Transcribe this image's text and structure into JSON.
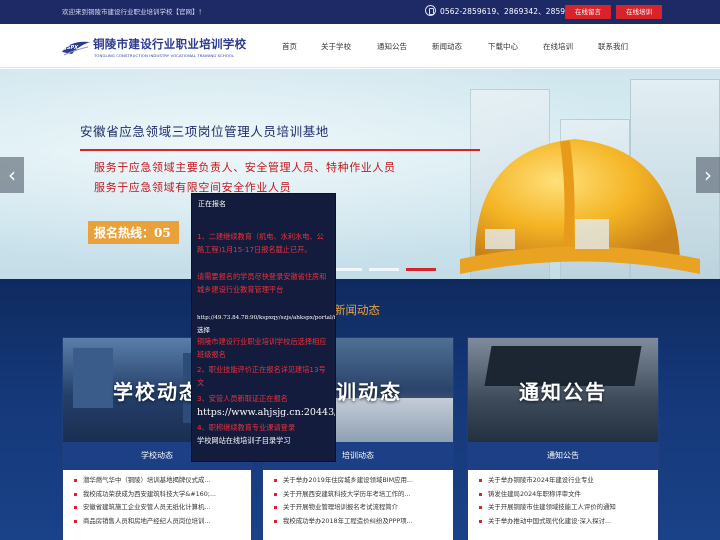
{
  "topbar": {
    "welcome": "欢迎来到铜陵市建设行业职业培训学校【官网】！",
    "phones": "0562-2859619、2869342、2859199",
    "online_message": "在线留言",
    "online_training": "在线培训"
  },
  "header": {
    "logo_badge": "JSPX",
    "logo_cn": "铜陵市建设行业职业培训学校",
    "logo_en": "TONGLING CONSTRUCTION INDUSTRY VOCATIONAL TRAINING SCHOOL",
    "nav": [
      "首页",
      "关于学校",
      "通知公告",
      "新闻动态",
      "下载中心",
      "在线培训",
      "联系我们"
    ]
  },
  "banner": {
    "title": "安徽省应急领域三项岗位管理人员培训基地",
    "line1": "服务于应急领域主要负责人、安全管理人员、特种作业人员",
    "line2": "服务于应急领域有限空间安全作业人员",
    "hotline": "报名热线：05",
    "prev": "‹",
    "next": "›",
    "slides": 3,
    "active_slide": 3
  },
  "section": {
    "title": "新闻动态"
  },
  "cards": [
    {
      "image_text": "学校动态",
      "caption": "学校动态",
      "items": [
        "潜华燃气华中（铜陵）培训基地揭牌仪式成...",
        "我校成功荣获成为西安建筑科技大学&#160;...",
        "安徽省建筑施工企业安管人员无纸化计算机...",
        "商品房销售人员和房地产经纪人员岗位培训..."
      ]
    },
    {
      "image_text": "培训动态",
      "caption": "培训动态",
      "items": [
        "关于举办2019年住房城乡建设领域BIM应用...",
        "关于开展西安建筑科技大学历年考培工作的...",
        "关于开展物业管理培训报名考试流程简介",
        "我校成功举办2018年工程造价纠纷及PPP项..."
      ]
    },
    {
      "image_text": "通知公告",
      "caption": "通知公告",
      "items": [
        "关于举办铜陵市2024年建设行业专业",
        "铸发住建局2024年职称评审文件",
        "关于开展铜陵市住建领域技能工人评价的通知",
        "关于举办推动中国式现代化建设·深入探讨..."
      ]
    }
  ],
  "popup": {
    "heading": "正在报名",
    "item1": "1、二建继续教育（机电、水利水电、公路工程)1月15-17日报名截止已开。",
    "item1b": "请需要报名的学员尽快登录安徽省住房和城乡建设行业教育管理平台",
    "url1": "http://49.73.84.78:90/kspxqy/szjs/ahkspx/portal/index#home",
    "choose": "选择",
    "item1c": "铜陵市建设行业职业培训学校后选择相应班级报名",
    "item2": "2、职业技能评价正在报名详见建培13号文",
    "item3": "3、安管人员新取证正在报名",
    "url2": "https://www.ahjsjg.cn:20443/notice/14",
    "item4": "4、职称继续教育专业课请登录",
    "item4b": "学校网站在线培训子目录学习"
  },
  "colors": {
    "top_bar": "#1e2a66",
    "accent_red": "#d8232a",
    "brand_blue": "#2a3a8f",
    "section_bg": "#143777",
    "section_title": "#e8a33d",
    "popup_bg": "#131c3c"
  }
}
